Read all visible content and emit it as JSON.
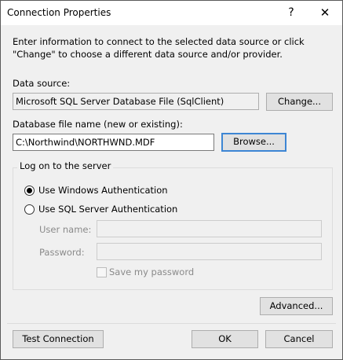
{
  "window": {
    "title": "Connection Properties",
    "help_glyph": "?",
    "close_glyph": "✕"
  },
  "intro": "Enter information to connect to the selected data source or click \"Change\" to choose a different data source and/or provider.",
  "data_source": {
    "label": "Data source:",
    "value": "Microsoft SQL Server Database File (SqlClient)",
    "change_button": "Change..."
  },
  "database_file": {
    "label": "Database file name (new or existing):",
    "value": "C:\\Northwind\\NORTHWND.MDF",
    "browse_button": "Browse..."
  },
  "logon": {
    "group_label": "Log on to the server",
    "windows_auth_label": "Use Windows Authentication",
    "windows_auth_selected": true,
    "sql_auth_label": "Use SQL Server Authentication",
    "sql_auth_selected": false,
    "username_label": "User name:",
    "username_value": "",
    "password_label": "Password:",
    "password_value": "",
    "save_password_label": "Save my password",
    "save_password_checked": false
  },
  "buttons": {
    "advanced": "Advanced...",
    "test_connection": "Test Connection",
    "ok": "OK",
    "cancel": "Cancel"
  }
}
